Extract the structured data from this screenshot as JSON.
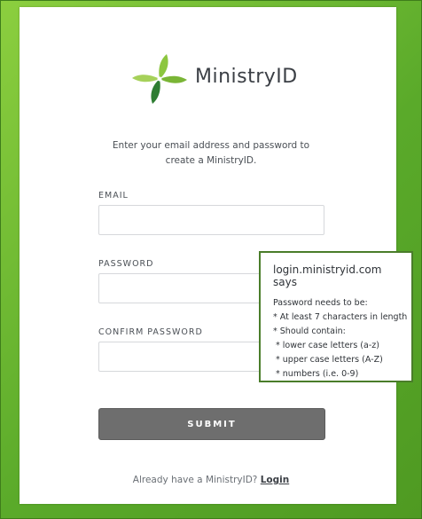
{
  "brand": {
    "name": "MinistryID"
  },
  "intro": {
    "text": "Enter your email address and password to create a MinistryID."
  },
  "form": {
    "email_label": "EMAIL",
    "email_value": "",
    "password_label": "PASSWORD",
    "password_value": "",
    "confirm_label": "CONFIRM PASSWORD",
    "confirm_value": "",
    "submit_label": "SUBMIT"
  },
  "footer": {
    "text": "Already have a MinistryID?",
    "login_label": "Login"
  },
  "dialog": {
    "title": "login.ministryid.com says",
    "lines": [
      "Password needs to be:",
      "* At least 7 characters in length",
      "* Should contain:",
      " * lower case letters (a-z)",
      " * upper case letters (A-Z)",
      " * numbers (i.e. 0-9)"
    ]
  },
  "colors": {
    "frame_green": "#6bbd34",
    "logo_green_light": "#8cc63f",
    "logo_green_dark": "#2e7d32",
    "submit_gray": "#6e6e6e",
    "dialog_border": "#4a7d2a"
  },
  "icons": {
    "logo": "leaf-star-logo-icon"
  }
}
